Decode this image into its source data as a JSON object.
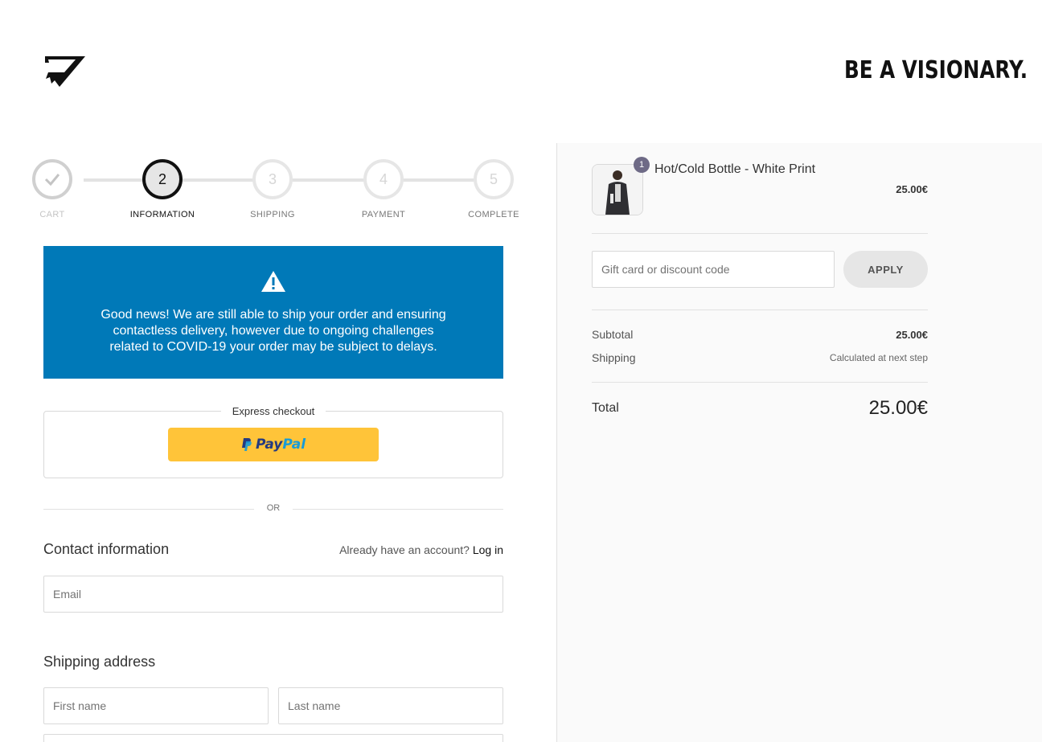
{
  "header": {
    "logo_icon": "shark-logo-icon",
    "tagline": "BE A VISIONARY."
  },
  "steps": [
    {
      "number": "✓",
      "label": "CART",
      "state": "done"
    },
    {
      "number": "2",
      "label": "INFORMATION",
      "state": "active"
    },
    {
      "number": "3",
      "label": "SHIPPING",
      "state": "upcoming"
    },
    {
      "number": "4",
      "label": "PAYMENT",
      "state": "upcoming"
    },
    {
      "number": "5",
      "label": "COMPLETE",
      "state": "upcoming"
    }
  ],
  "banner": {
    "icon": "warning-icon",
    "message": "Good news! We are still able to ship your order and ensuring contactless delivery, however due to ongoing challenges related to COVID-19 your order may be subject to delays.",
    "color": "#0079b8"
  },
  "express": {
    "title": "Express checkout",
    "paypal_part1": "Pay",
    "paypal_part2": "Pal"
  },
  "divider": {
    "or": "OR"
  },
  "contact": {
    "title": "Contact information",
    "account_prompt": "Already have an account?",
    "login_link": "Log in",
    "email_placeholder": "Email"
  },
  "shipping": {
    "title": "Shipping address",
    "first_name_placeholder": "First name",
    "last_name_placeholder": "Last name"
  },
  "summary": {
    "product": {
      "name": "Hot/Cold Bottle - White Print",
      "quantity": "1",
      "price": "25.00€"
    },
    "discount_placeholder": "Gift card or discount code",
    "apply_label": "APPLY",
    "subtotal_label": "Subtotal",
    "subtotal_value": "25.00€",
    "shipping_label": "Shipping",
    "shipping_value": "Calculated at next step",
    "total_label": "Total",
    "total_value": "25.00€"
  }
}
